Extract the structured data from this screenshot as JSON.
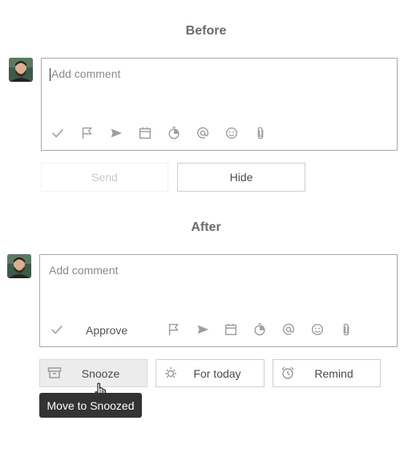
{
  "before": {
    "title": "Before",
    "comment_placeholder": "Add comment",
    "toolbar_icons": [
      "check-icon",
      "flag-icon",
      "send-arrow-icon",
      "calendar-icon",
      "timer-icon",
      "at-icon",
      "smiley-icon",
      "paperclip-icon"
    ],
    "send_label": "Send",
    "hide_label": "Hide"
  },
  "after": {
    "title": "After",
    "comment_placeholder": "Add comment",
    "approve_label": "Approve",
    "toolbar_icons": [
      "check-icon",
      "flag-icon",
      "send-arrow-icon",
      "calendar-icon",
      "timer-icon",
      "at-icon",
      "smiley-icon",
      "paperclip-icon"
    ],
    "snooze_label": "Snooze",
    "for_today_label": "For today",
    "remind_label": "Remind",
    "tooltip": "Move to Snoozed"
  },
  "colors": {
    "icon_gray": "#9e9e9e",
    "border": "#a9a9a9",
    "tooltip_bg": "#333333",
    "snooze_bg": "#ececec"
  }
}
